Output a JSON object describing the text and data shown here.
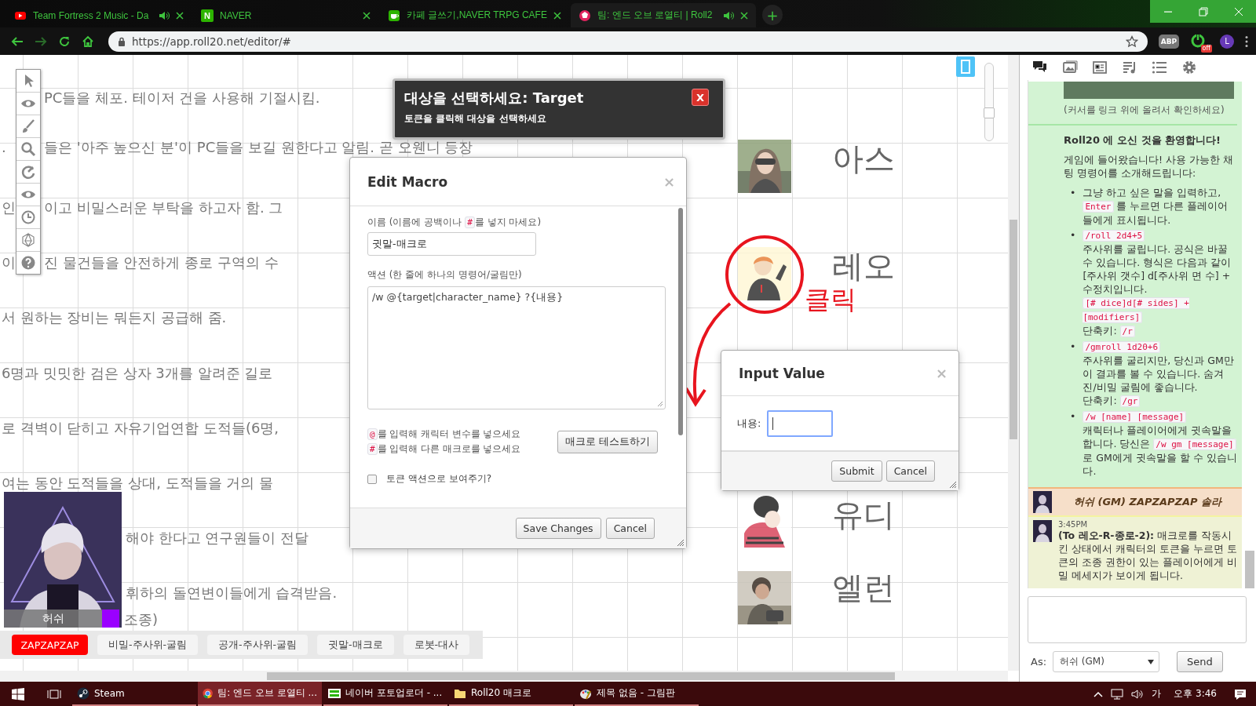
{
  "browser": {
    "tabs": [
      {
        "kind": "youtube",
        "title": "Team Fortress 2 Music - Da",
        "audio": true,
        "selected": false
      },
      {
        "kind": "naver",
        "badge": "N",
        "title": "NAVER",
        "audio": false,
        "selected": false
      },
      {
        "kind": "cafe",
        "title": "카페 글쓰기,NAVER TRPG CAFE",
        "audio": false,
        "selected": false
      },
      {
        "kind": "roll20",
        "title": "팀: 엔드 오브 로열티 | Roll2",
        "audio": true,
        "selected": true
      }
    ],
    "new_tab": "+",
    "url": "https://app.roll20.net/editor/#",
    "extensions": [
      {
        "kind": "abp",
        "label": "ABP"
      },
      {
        "kind": "toggle",
        "badge": "off"
      },
      {
        "kind": "profile",
        "label": "L"
      }
    ]
  },
  "toolbar": {
    "tools": [
      {
        "kind": "pointer"
      },
      {
        "kind": "eye"
      },
      {
        "kind": "brush"
      },
      {
        "kind": "zoom"
      },
      {
        "kind": "measure"
      },
      {
        "kind": "eye"
      },
      {
        "kind": "clock"
      },
      {
        "kind": "dice"
      },
      {
        "kind": "help"
      }
    ]
  },
  "zoom": {
    "level": 0.35
  },
  "canvas_lines": [
    {
      "text": "PC들을 체포. 테이저 건을 사용해 기절시킴."
    },
    {
      "lead": ".",
      "text": "들은 '아주 높으신 분'이 PC들을 보길 원한다고 알림. 곧 오웬니 등장"
    },
    {
      "lead": "인",
      "text": "이고 비밀스러운 부탁을 하고자 함. 그"
    },
    {
      "lead": "이",
      "text": "진 물건들을 안전하게 종로 구역의 수"
    },
    {
      "text": "서 원하는 장비는 뭐든지 공급해 줌."
    },
    {
      "text": "6명과 밋밋한 검은 상자 3개를 알려준 길로"
    },
    {
      "text": "로 격벽이 닫히고 자유기업연합 도적들(6명,"
    },
    {
      "text": "여는 동안 도적들을 상대, 도적들을 거의 물"
    },
    {
      "text": "해야 한다고 연구원들이 전달"
    },
    {
      "text": "휘하의 돌연변이들에게 습격받음."
    },
    {
      "text": "조종)"
    }
  ],
  "tokens": [
    {
      "label": "아스",
      "marked": false
    },
    {
      "label": "레오",
      "marked": true
    },
    {
      "label": "유디",
      "marked": false
    },
    {
      "label": "엘런",
      "marked": false
    }
  ],
  "annotation": {
    "label": "클릭"
  },
  "portrait": {
    "name": "허쉬"
  },
  "target_prompt": {
    "title": "대상을 선택하세요: Target",
    "subtitle": "토큰을 클릭해 대상을 선택하세요",
    "close": "X"
  },
  "edit_macro": {
    "title": "Edit Macro",
    "close": "×",
    "name_label": [
      {
        "kind": "text",
        "text": "이름 (이름에 공백이나 "
      },
      {
        "kind": "code",
        "text": "#"
      },
      {
        "kind": "text",
        "text": "를 넣지 마세요)"
      }
    ],
    "name_value": "귓말-매크로",
    "action_label": "액션 (한 줄에 하나의 명령어/굴림만)",
    "action_value": "/w @{target|character_name} ?{내용}",
    "hints": [
      [
        {
          "kind": "code",
          "text": "@"
        },
        {
          "kind": "text",
          "text": "를 입력해 캐릭터 변수를 넣으세요"
        }
      ],
      [
        {
          "kind": "code",
          "text": "#"
        },
        {
          "kind": "text",
          "text": "를 입력해 다른 매크로를 넣으세요"
        }
      ]
    ],
    "test_button": "매크로 테스트하기",
    "token_action": {
      "label": "토큰 액션으로 보여주기?",
      "checked": false
    },
    "buttons": [
      "Save Changes",
      "Cancel"
    ]
  },
  "input_value": {
    "title": "Input Value",
    "close": "×",
    "label": "내용:",
    "focused": true,
    "buttons": [
      "Submit",
      "Cancel"
    ]
  },
  "macro_bar": [
    {
      "label": "ZAPZAPZAP",
      "kind": "primary"
    },
    {
      "label": "비밀-주사위-굴림",
      "kind": "plain"
    },
    {
      "label": "공개-주사위-굴림",
      "kind": "plain"
    },
    {
      "label": "귓말-매크로",
      "kind": "plain"
    },
    {
      "label": "로봇-대사",
      "kind": "plain"
    }
  ],
  "chat": {
    "tabs": [
      {
        "kind": "chat",
        "selected": true
      },
      {
        "kind": "art",
        "selected": false
      },
      {
        "kind": "journal",
        "selected": false
      },
      {
        "kind": "jukebox",
        "selected": false
      },
      {
        "kind": "list",
        "selected": false
      },
      {
        "kind": "settings",
        "selected": false
      }
    ],
    "notice": "(커서를 링크 위에 올려서 확인하세요)",
    "welcome_title": "Roll20 에 오신 것을 환영합니다!",
    "welcome_intro": "게임에 들어왔습니다! 사용 가능한 채팅 명령어를 소개해드립니다:",
    "commands": [
      {
        "marker": "•",
        "blocks": [
          [
            {
              "kind": "text",
              "text": "그냥 하고 싶은 말을 입력하고, "
            },
            {
              "kind": "code",
              "text": "Enter"
            },
            {
              "kind": "text",
              "text": " 를 누르면 다른 플레이어들에게 표시됩니다."
            }
          ]
        ]
      },
      {
        "marker": "•",
        "blocks": [
          [
            {
              "kind": "code",
              "text": "/roll 2d4+5"
            }
          ],
          [
            {
              "kind": "text",
              "text": "주사위를 굴립니다. 공식은 바꿀 수 있습니다. 형식은 다음과 같이 [주사위 갯수] d[주사위 면 수] + 수정치입니다."
            }
          ],
          [
            {
              "kind": "code",
              "text": "[# dice]d[# sides] + [modifiers]"
            }
          ],
          [
            {
              "kind": "text",
              "text": "단축키: "
            },
            {
              "kind": "code",
              "text": "/r"
            }
          ]
        ]
      },
      {
        "marker": "•",
        "blocks": [
          [
            {
              "kind": "code",
              "text": "/gmroll 1d20+6"
            }
          ],
          [
            {
              "kind": "text",
              "text": "주사위를 굴리지만, 당신과 GM만이 결과를 볼 수 있습니다. 숨겨진/비밀 굴림에 좋습니다."
            }
          ],
          [
            {
              "kind": "text",
              "text": "단축키: "
            },
            {
              "kind": "code",
              "text": "/gr"
            }
          ]
        ]
      },
      {
        "marker": "•",
        "blocks": [
          [
            {
              "kind": "code",
              "text": "/w [name] [message]"
            }
          ],
          [
            {
              "kind": "text",
              "text": "캐릭터나 플레이어에게 귓속말을 합니다. 당신은 "
            },
            {
              "kind": "code",
              "text": "/w gm [message]"
            },
            {
              "kind": "text",
              "text": " 로 GM에게 귓속말을 할 수 있습니다."
            }
          ]
        ]
      }
    ],
    "messages": [
      {
        "kind": "emote",
        "text": "허쉬 (GM) ZAPZAPZAP 솔라"
      },
      {
        "kind": "whisper",
        "time": "3:45PM",
        "to": "(To 레오-R-종로-2):",
        "text": "매크로를 작동시킨 상태에서 캐릭터의 토큰을 누르면 토큰의 조종 권한이 있는 플레이어에게 비밀 메세지가 보이게 됩니다."
      }
    ],
    "as_label": "As:",
    "as_value": "허쉬 (GM)",
    "send": "Send"
  },
  "taskbar": {
    "apps": [
      {
        "kind": "steam",
        "label": "Steam",
        "selected": false
      },
      {
        "kind": "chrome",
        "label": "팀: 엔드 오브 로열티 ...",
        "selected": true
      },
      {
        "label": "네이버 포토업로더 - ...",
        "selected": false
      },
      {
        "kind": "folder",
        "label": "Roll20 매크로",
        "selected": false
      },
      {
        "kind": "paint",
        "label": "제목 없음 - 그림판",
        "selected": false
      }
    ],
    "ime": "가",
    "clock": "오후 3:46"
  }
}
